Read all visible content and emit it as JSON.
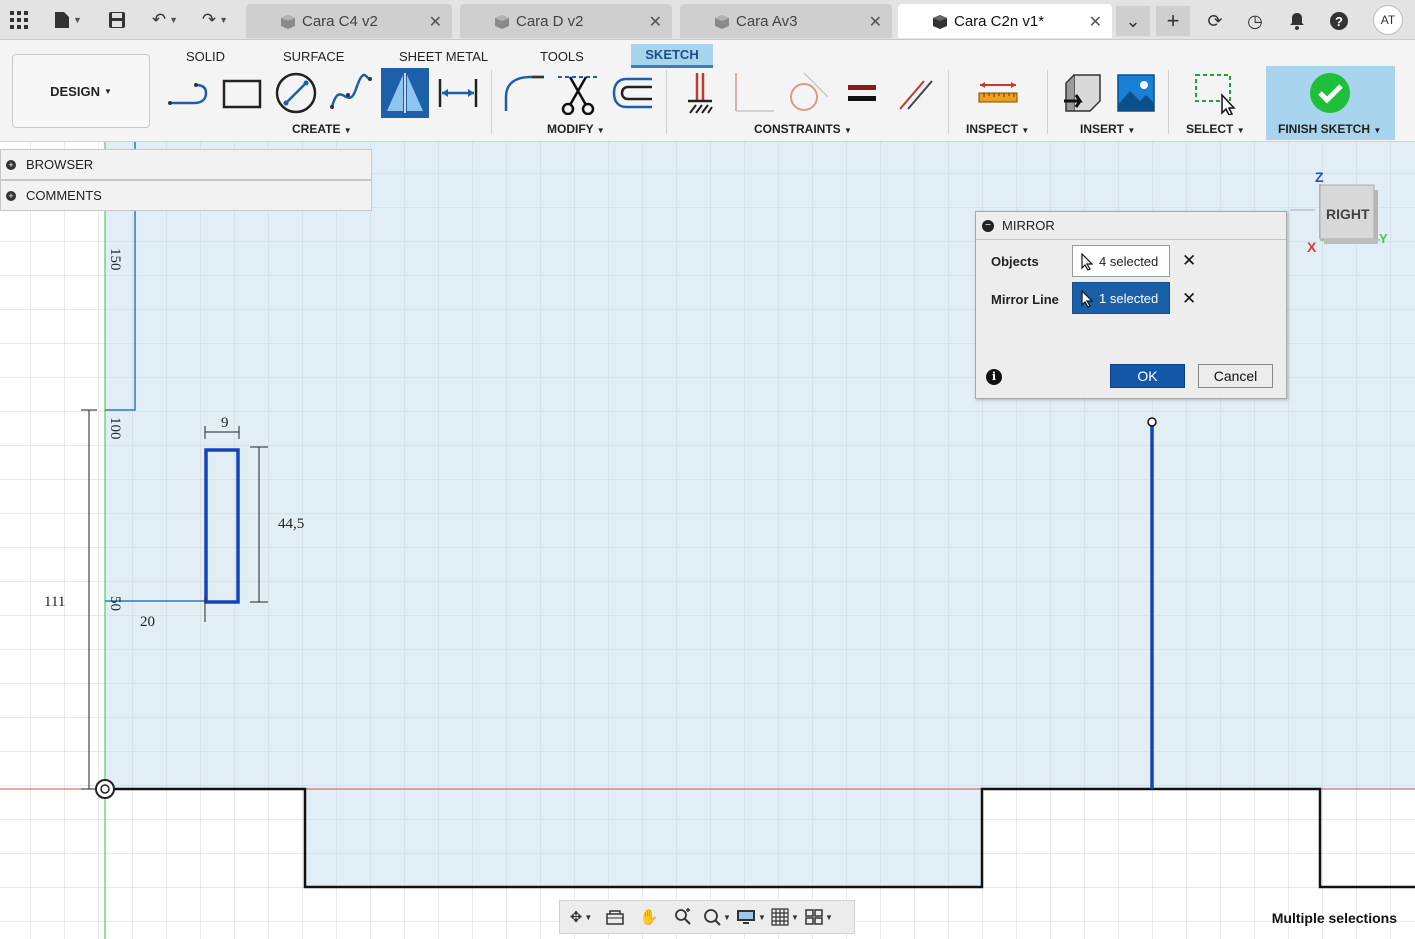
{
  "tabs": [
    {
      "label": "Cara C4 v2",
      "active": false
    },
    {
      "label": "Cara D v2",
      "active": false
    },
    {
      "label": "Cara Av3",
      "active": false
    },
    {
      "label": "Cara C2n v1*",
      "active": true
    }
  ],
  "user": {
    "initials": "AT"
  },
  "ribbon": {
    "tabs": [
      "SOLID",
      "SURFACE",
      "SHEET METAL",
      "TOOLS",
      "SKETCH"
    ],
    "active_tab": "SKETCH",
    "workspace": "DESIGN",
    "groups": {
      "create": "CREATE",
      "modify": "MODIFY",
      "constraints": "CONSTRAINTS",
      "inspect": "INSPECT",
      "insert": "INSERT",
      "select": "SELECT",
      "finish": "FINISH SKETCH"
    }
  },
  "browser": {
    "browser_label": "BROWSER",
    "comments_label": "COMMENTS"
  },
  "mirror_dialog": {
    "title": "MIRROR",
    "objects_label": "Objects",
    "objects_value": "4 selected",
    "mirror_line_label": "Mirror Line",
    "mirror_line_value": "1 selected",
    "ok_label": "OK",
    "cancel_label": "Cancel"
  },
  "viewcube": {
    "face": "RIGHT",
    "axis_z": "Z",
    "axis_x": "X",
    "axis_y": "Y"
  },
  "sketch": {
    "dimensions": {
      "d150": "150",
      "d100": "100",
      "d50": "50",
      "d9": "9",
      "d44_5": "44,5",
      "d111": "111",
      "d20": "20"
    }
  },
  "status": {
    "text": "Multiple selections"
  },
  "colors": {
    "accent": "#1b5fa8",
    "sketch_fill": "#e1eef6",
    "finish_green": "#1fbf3a",
    "sketch_blue": "#1544b8"
  }
}
